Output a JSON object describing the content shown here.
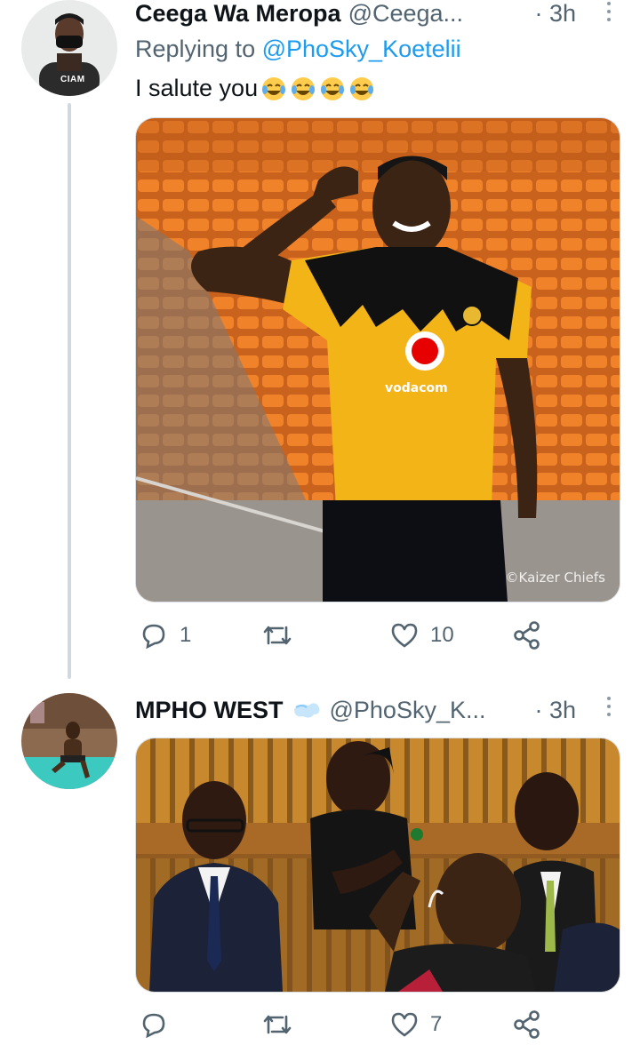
{
  "tweets": [
    {
      "author_name": "Ceega Wa Meropa",
      "handle": "@Ceega...",
      "time": "· 3h",
      "replying_prefix": "Replying to ",
      "replying_to": "@PhoSky_Koetelii",
      "text": "I salute you",
      "emoji": [
        "face-with-tears-of-joy",
        "face-with-tears-of-joy",
        "face-with-tears-of-joy",
        "face-with-tears-of-joy"
      ],
      "avatar_badge": "CIAM",
      "media_watermark": "©Kaizer Chiefs",
      "jersey_sponsor": "vodacom",
      "actions": {
        "replies": "1",
        "retweets": "",
        "likes": "10"
      }
    },
    {
      "author_name": "MPHO WEST",
      "handle": "@PhoSky_K...",
      "time": "· 3h",
      "name_emoji": "dashing-away",
      "actions": {
        "replies": "",
        "retweets": "",
        "likes": "7"
      }
    }
  ],
  "colors": {
    "text": "#0f1419",
    "secondary": "#536471",
    "link": "#1d9bf0",
    "thread_line": "#cfd9de"
  },
  "icons": [
    "reply-icon",
    "retweet-icon",
    "like-icon",
    "share-icon",
    "more-icon"
  ]
}
